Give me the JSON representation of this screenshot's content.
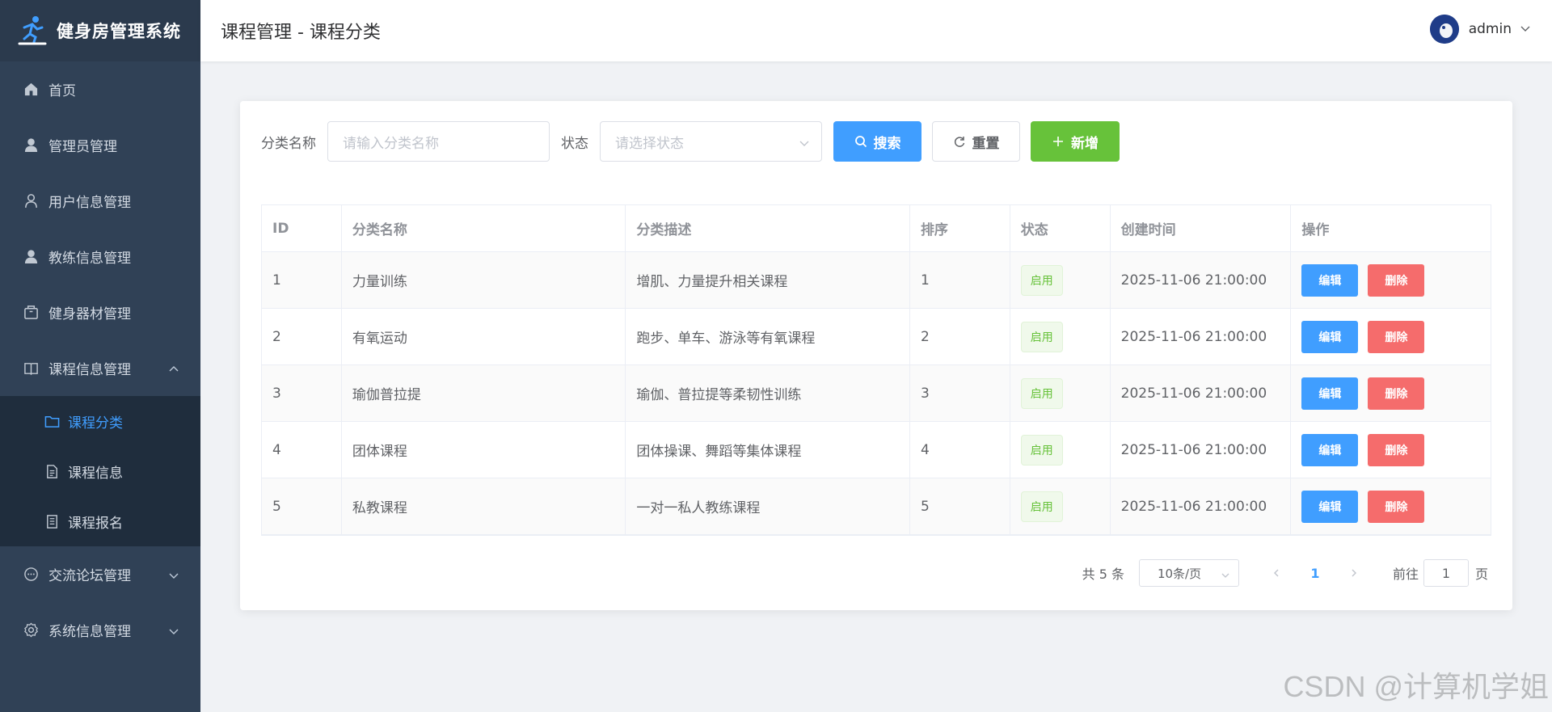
{
  "app": {
    "title": "健身房管理系统"
  },
  "sidebar": {
    "items": [
      {
        "label": "首页",
        "icon": "home-icon"
      },
      {
        "label": "管理员管理",
        "icon": "user-filled-icon"
      },
      {
        "label": "用户信息管理",
        "icon": "user-icon"
      },
      {
        "label": "教练信息管理",
        "icon": "user-filled-icon"
      },
      {
        "label": "健身器材管理",
        "icon": "box-icon"
      },
      {
        "label": "课程信息管理",
        "icon": "book-icon",
        "expanded": true
      }
    ],
    "sub_items": [
      {
        "label": "课程分类",
        "icon": "folder-icon",
        "active": true
      },
      {
        "label": "课程信息",
        "icon": "document-icon"
      },
      {
        "label": "课程报名",
        "icon": "list-icon"
      }
    ],
    "bottom_items": [
      {
        "label": "交流论坛管理",
        "icon": "chat-icon"
      },
      {
        "label": "系统信息管理",
        "icon": "gear-icon"
      }
    ]
  },
  "header": {
    "title": "课程管理 - 课程分类",
    "username": "admin"
  },
  "filter": {
    "name_label": "分类名称",
    "name_placeholder": "请输入分类名称",
    "status_label": "状态",
    "status_placeholder": "请选择状态",
    "search_label": "搜索",
    "reset_label": "重置",
    "add_label": "新增"
  },
  "table": {
    "columns": [
      "ID",
      "分类名称",
      "分类描述",
      "排序",
      "状态",
      "创建时间",
      "操作"
    ],
    "rows": [
      {
        "id": "1",
        "name": "力量训练",
        "desc": "增肌、力量提升相关课程",
        "sort": "1",
        "status": "启用",
        "created": "2025-11-06 21:00:00"
      },
      {
        "id": "2",
        "name": "有氧运动",
        "desc": "跑步、单车、游泳等有氧课程",
        "sort": "2",
        "status": "启用",
        "created": "2025-11-06 21:00:00"
      },
      {
        "id": "3",
        "name": "瑜伽普拉提",
        "desc": "瑜伽、普拉提等柔韧性训练",
        "sort": "3",
        "status": "启用",
        "created": "2025-11-06 21:00:00"
      },
      {
        "id": "4",
        "name": "团体课程",
        "desc": "团体操课、舞蹈等集体课程",
        "sort": "4",
        "status": "启用",
        "created": "2025-11-06 21:00:00"
      },
      {
        "id": "5",
        "name": "私教课程",
        "desc": "一对一私人教练课程",
        "sort": "5",
        "status": "启用",
        "created": "2025-11-06 21:00:00"
      }
    ],
    "edit_label": "编辑",
    "delete_label": "删除"
  },
  "pagination": {
    "total": "共 5 条",
    "page_size": "10条/页",
    "current_page": "1",
    "goto_label": "前往",
    "goto_value": "1",
    "page_suffix": "页"
  },
  "watermark": "CSDN @计算机学姐",
  "colors": {
    "primary": "#409eff",
    "success": "#67c23a",
    "danger": "#f56c6c",
    "sidebar": "#304156"
  }
}
